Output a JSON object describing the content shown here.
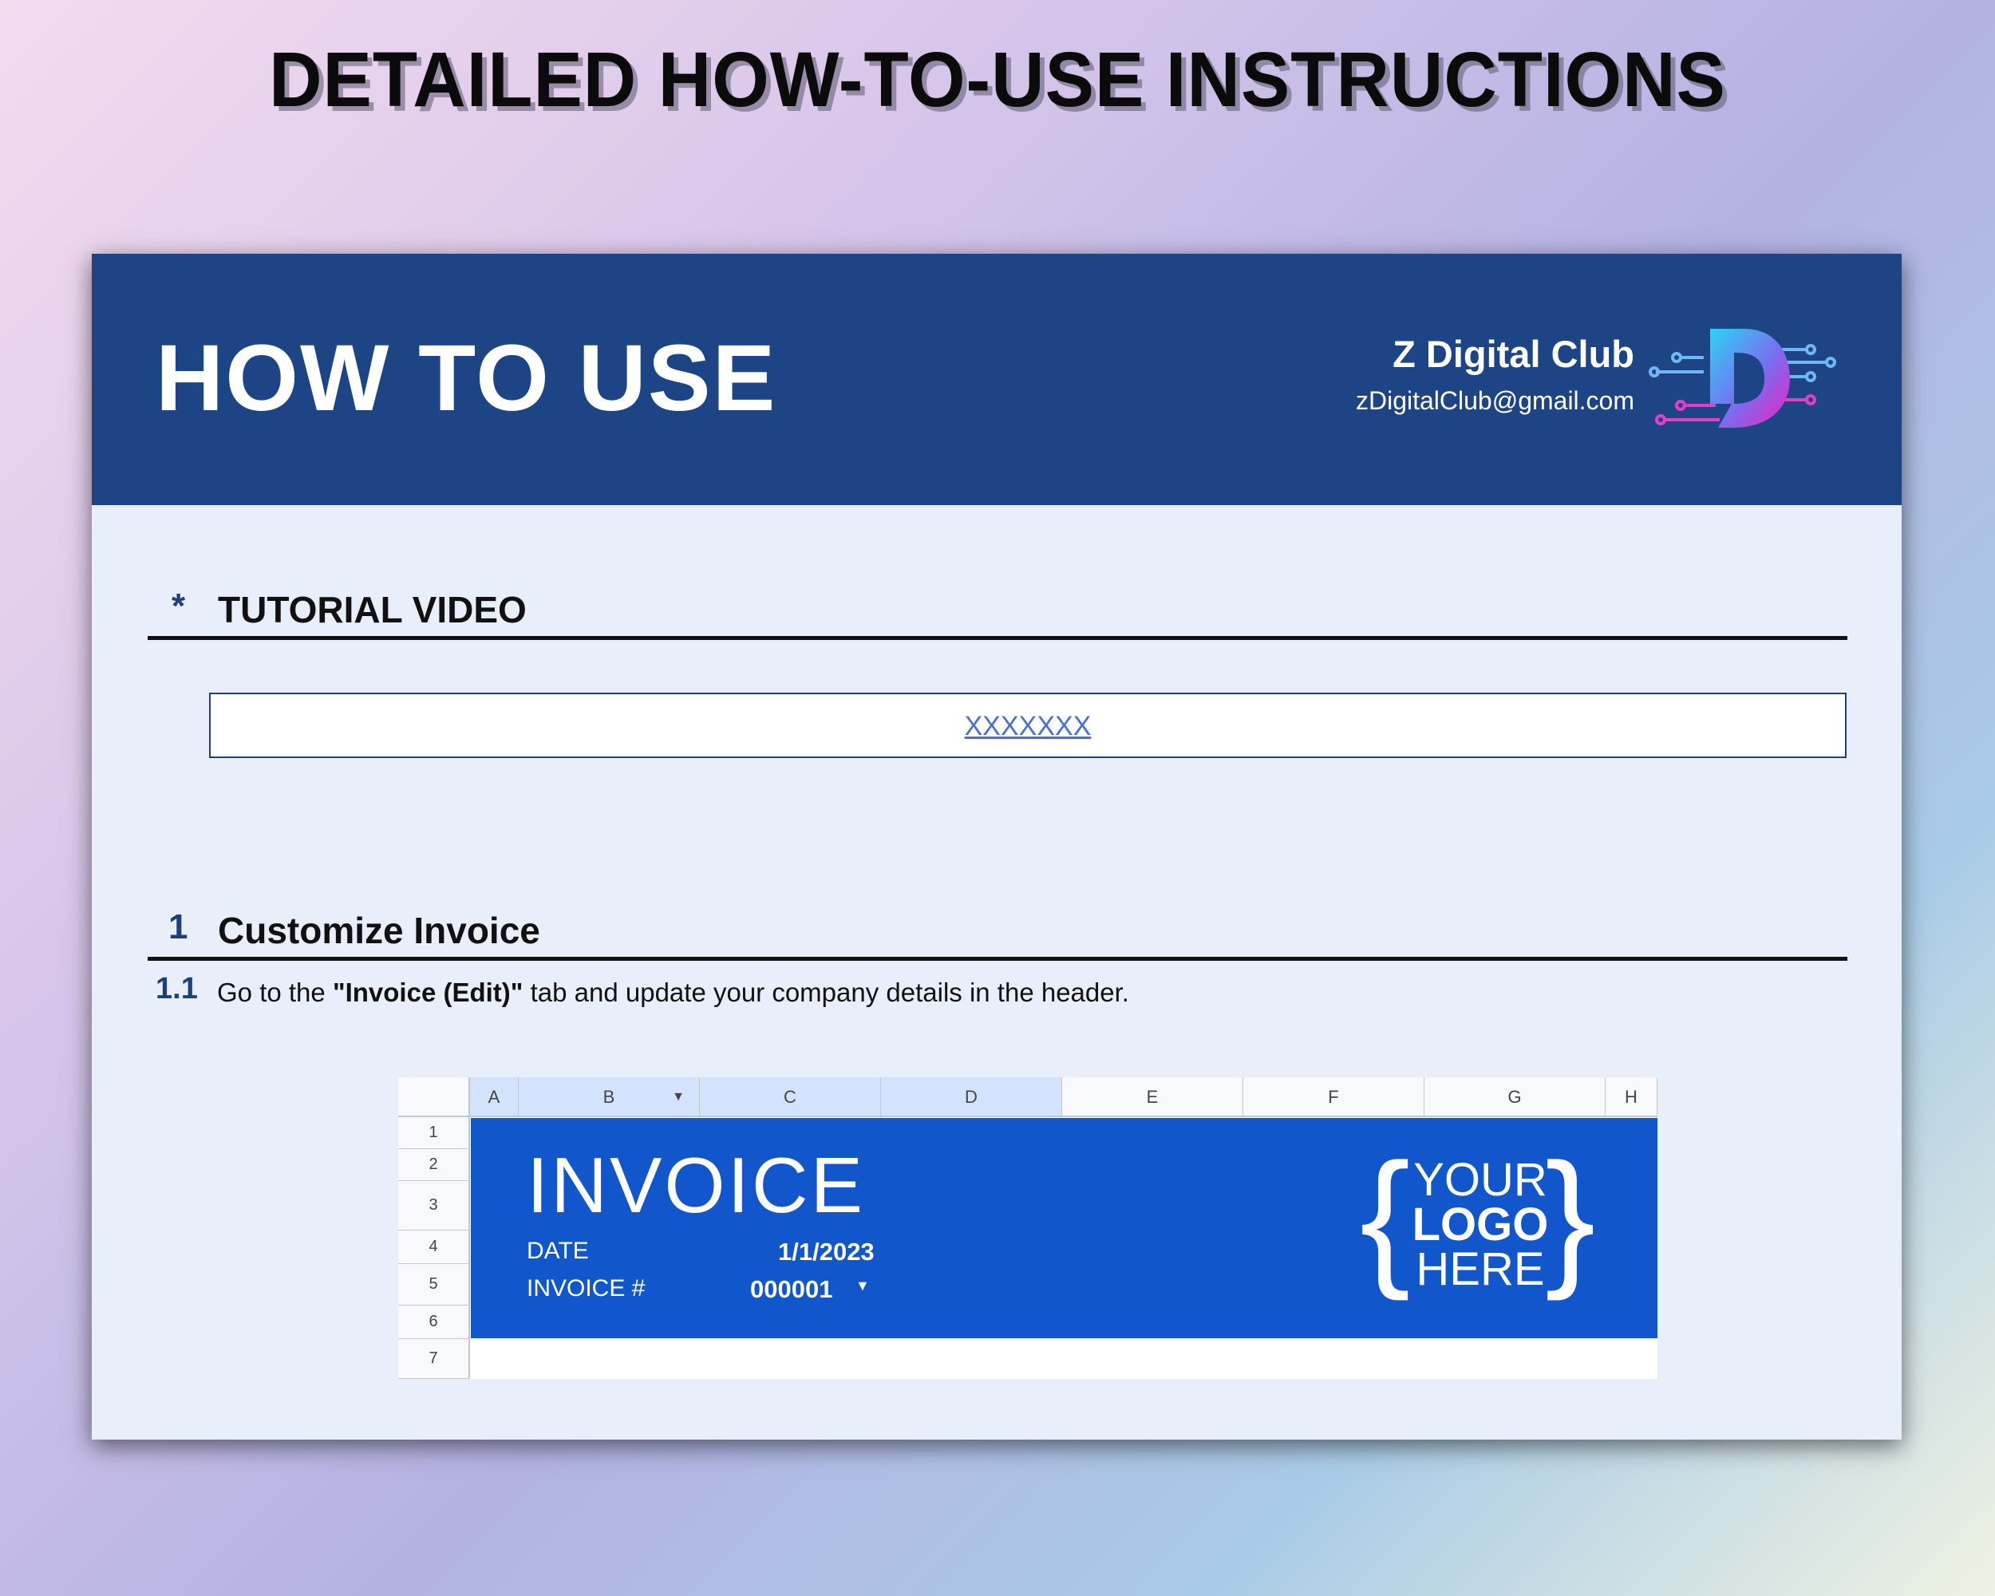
{
  "page_title": "DETAILED HOW-TO-USE INSTRUCTIONS",
  "header": {
    "title": "HOW TO USE",
    "brand_name": "Z Digital Club",
    "brand_email": "zDigitalClub@gmail.com"
  },
  "tutorial": {
    "marker": "*",
    "label": "TUTORIAL VIDEO",
    "link_text": "XXXXXXX"
  },
  "section1": {
    "number": "1",
    "label": "Customize Invoice",
    "step": {
      "number": "1.1",
      "text_before": "Go to the ",
      "text_bold": "\"Invoice (Edit)\"",
      "text_after": " tab and update your company details in the header."
    }
  },
  "sheet": {
    "columns": [
      "A",
      "B",
      "C",
      "D",
      "E",
      "F",
      "G",
      "H"
    ],
    "rows": [
      "1",
      "2",
      "3",
      "4",
      "5",
      "6",
      "7"
    ],
    "invoice": {
      "title": "INVOICE",
      "date_label": "DATE",
      "date_value": "1/1/2023",
      "number_label": "INVOICE #",
      "number_value": "000001",
      "logo_lines": [
        "YOUR",
        "LOGO",
        "HERE"
      ]
    }
  },
  "colors": {
    "header_bg": "#1d4586",
    "card_bg": "#e8effb",
    "invoice_band": "#1256cc",
    "link": "#4a6fd1"
  }
}
